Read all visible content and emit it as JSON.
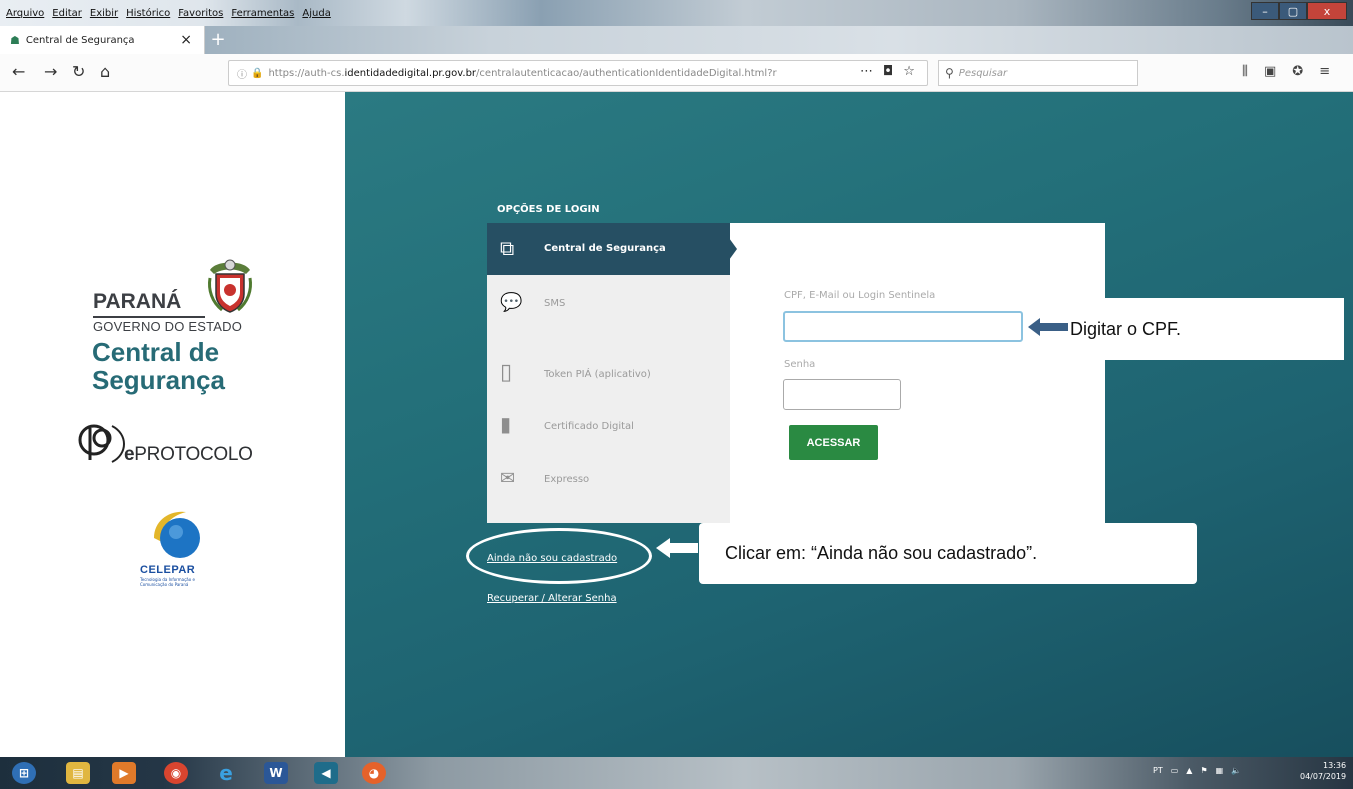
{
  "browser": {
    "menu": [
      "Arquivo",
      "Editar",
      "Exibir",
      "Histórico",
      "Favoritos",
      "Ferramentas",
      "Ajuda"
    ],
    "tab_title": "Central de Segurança",
    "tab_close": "×",
    "new_tab": "+",
    "url_prefix": "https://auth-cs.",
    "url_host": "identidadedigital.pr.gov.br",
    "url_path": "/centralautenticacao/authenticationIdentidadeDigital.html?r",
    "search_placeholder": "Pesquisar",
    "window_controls": {
      "minimize": "–",
      "maximize": "▢",
      "close": "x"
    }
  },
  "left_panel": {
    "parana": "PARANÁ",
    "governo": "GOVERNO DO ESTADO",
    "central_line1": "Central de",
    "central_line2": "Segurança",
    "eprotocolo_e": "e",
    "eprotocolo_rest": "PROTOCOLO",
    "celepar": "CELEPAR",
    "celepar_sub": "Tecnologia da Informação e Comunicação do Paraná"
  },
  "login": {
    "options_title": "OPÇÕES DE LOGIN",
    "menu": [
      {
        "label": "Central de Segurança",
        "icon": "security-search-icon"
      },
      {
        "label": "SMS",
        "icon": "sms-icon"
      },
      {
        "label": "Token PIÁ (aplicativo)",
        "icon": "phone-icon"
      },
      {
        "label": "Certificado Digital",
        "icon": "usb-token-icon"
      },
      {
        "label": "Expresso",
        "icon": "envelope-icon"
      }
    ],
    "cpf_label": "CPF, E-Mail ou Login Sentinela",
    "cpf_value": "",
    "password_label": "Senha",
    "password_value": "",
    "submit": "ACESSAR",
    "register_link": "Ainda não sou cadastrado",
    "recover_link": "Recuperar / Alterar Senha"
  },
  "annotations": {
    "cpf_note": "Digitar o CPF.",
    "register_note": "Clicar em: “Ainda não sou cadastrado”."
  },
  "taskbar": {
    "language": "PT",
    "time": "13:36",
    "date": "04/07/2019"
  },
  "colors": {
    "teal_bg": "#236f79",
    "menu_active": "#264f63",
    "button_green": "#2a8a42",
    "brand_teal": "#276b76"
  }
}
